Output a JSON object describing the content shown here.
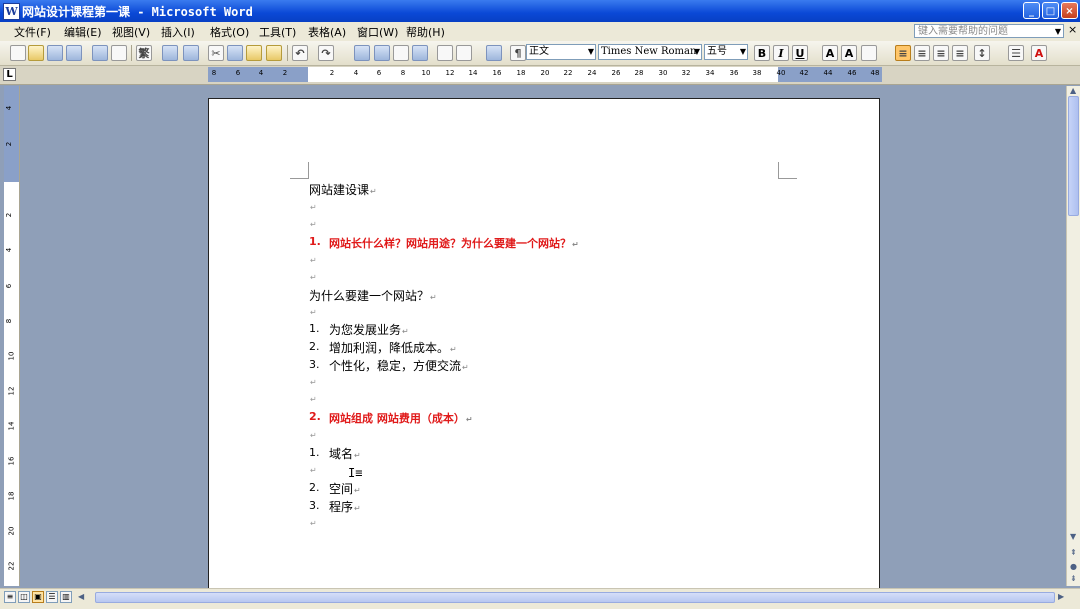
{
  "window": {
    "title": "网站设计课程第一课 - Microsoft Word",
    "controls": {
      "minimize": "_",
      "maximize": "□",
      "close": "×"
    }
  },
  "menu": {
    "items": [
      "文件(F)",
      "编辑(E)",
      "视图(V)",
      "插入(I)",
      "格式(O)",
      "工具(T)",
      "表格(A)",
      "窗口(W)",
      "帮助(H)"
    ],
    "help_placeholder": "键入需要帮助的问题",
    "close_doc": "×"
  },
  "toolbar": {
    "style_value": "正文",
    "font_value": "Times New Roman",
    "size_value": "五号",
    "bold": "B",
    "italic": "I",
    "underline": "U",
    "font_color_label": "A",
    "font_color": "#d01010"
  },
  "ruler": {
    "horizontal": [
      "8",
      "6",
      "4",
      "2",
      "2",
      "4",
      "6",
      "8",
      "10",
      "12",
      "14",
      "16",
      "18",
      "20",
      "22",
      "24",
      "26",
      "28",
      "30",
      "32",
      "34",
      "36",
      "38",
      "40",
      "42",
      "44",
      "46",
      "48"
    ],
    "vertical": [
      "4",
      "2",
      "2",
      "4",
      "6",
      "8",
      "10",
      "12",
      "14",
      "16",
      "18",
      "20",
      "22"
    ]
  },
  "document": {
    "heading": "网站建设课",
    "section1": {
      "number": "1.",
      "text": "网站长什么样？网站用途？为什么要建一个网站？"
    },
    "question": "为什么要建一个网站？",
    "reasons": [
      {
        "number": "1.",
        "text": "为您发展业务"
      },
      {
        "number": "2.",
        "text": "增加利润，降低成本。"
      },
      {
        "number": "3.",
        "text": "个性化，稳定，方便交流"
      }
    ],
    "section2": {
      "number": "2.",
      "text": "网站组成 网站费用（成本）"
    },
    "components": [
      {
        "number": "1.",
        "text": "域名"
      },
      {
        "number": "2.",
        "text": "空间"
      },
      {
        "number": "3.",
        "text": "程序"
      }
    ],
    "paragraph_mark": "↵"
  },
  "colors": {
    "heading_red": "#e01a1a",
    "title_bar": "#0a48d6"
  }
}
